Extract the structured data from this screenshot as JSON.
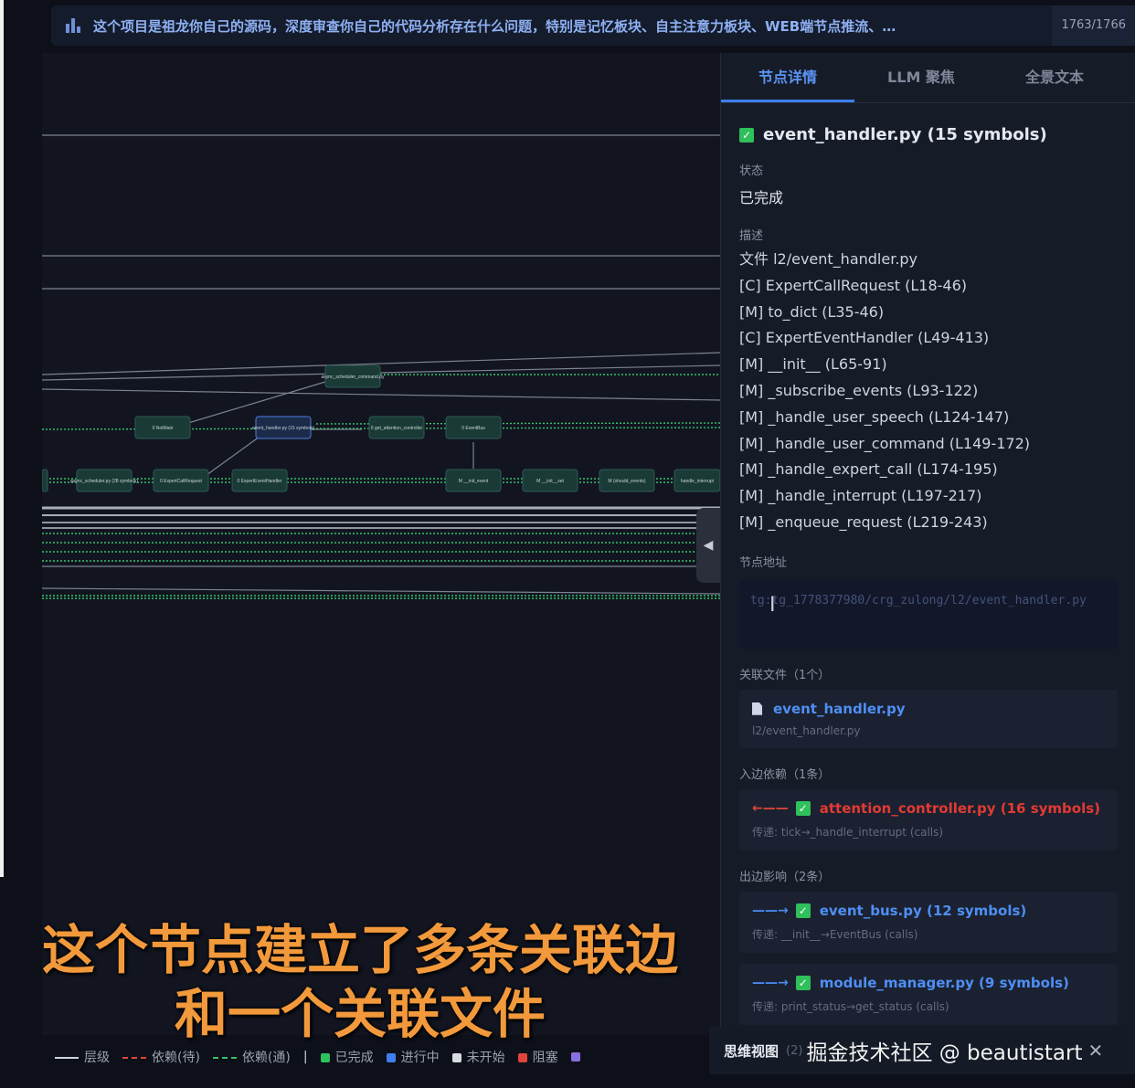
{
  "topbar": {
    "text": "这个项目是祖龙你自己的源码，深度审查你自己的代码分析存在什么问题，特别是记忆板块、自主注意力板块、WEB端节点推流、…",
    "count": "1763/1766",
    "icon": "bar-chart-icon"
  },
  "graph": {
    "nodes": [
      {
        "label": "async_scheduler_command.py"
      },
      {
        "label": "0 NotMain"
      },
      {
        "label": "event_handler.py (15 symbols)"
      },
      {
        "label": "0 get_attention_controller"
      },
      {
        "label": "0 EventBus"
      },
      {
        "label": "async_scheduler.py (28 symbols)"
      },
      {
        "label": "0 ExpertCallRequest"
      },
      {
        "label": "0 ExpertEventHandler"
      },
      {
        "label": "M __init_event"
      },
      {
        "label": "M __init__set"
      },
      {
        "label": "M (should_events)"
      },
      {
        "label": "handle_interrupt"
      }
    ],
    "collapse_icon": "triangle-left-icon"
  },
  "panel": {
    "tabs": [
      {
        "label": "节点详情",
        "active": true
      },
      {
        "label": "LLM 聚焦",
        "active": false
      },
      {
        "label": "全景文本",
        "active": false
      }
    ],
    "title": "event_handler.py (15 symbols)",
    "status_label": "状态",
    "status_value": "已完成",
    "desc_label": "描述",
    "desc_lines": [
      "文件 l2/event_handler.py",
      "[C] ExpertCallRequest (L18-46)",
      "[M] to_dict (L35-46)",
      "[C] ExpertEventHandler (L49-413)",
      "[M] __init__ (L65-91)",
      "[M] _subscribe_events (L93-122)",
      "[M] _handle_user_speech (L124-147)",
      "[M] _handle_user_command (L149-172)",
      "[M] _handle_expert_call (L174-195)",
      "[M] _handle_interrupt (L197-217)",
      "[M] _enqueue_request (L219-243)"
    ],
    "addr_label": "节点地址",
    "addr_value": "tg:tg_1778377980/crg_zulong/l2/event_handler.py",
    "files_label": "关联文件（1个）",
    "file": {
      "name": "event_handler.py",
      "path": "l2/event_handler.py",
      "icon": "file-icon"
    },
    "in_label": "入边依赖（1条）",
    "in_edges": [
      {
        "arrow": "←——",
        "name": "attention_controller.py (16 symbols)",
        "detail": "传递: tick→_handle_interrupt (calls)"
      }
    ],
    "out_label": "出边影响（2条）",
    "out_edges": [
      {
        "arrow": "——→",
        "name": "event_bus.py (12 symbols)",
        "detail": "传递: __init__→EventBus (calls)"
      },
      {
        "arrow": "——→",
        "name": "module_manager.py (9 symbols)",
        "detail": "传递: print_status→get_status (calls)"
      }
    ]
  },
  "legend": {
    "items": [
      {
        "label": "层级",
        "style": "solid",
        "color": "#d0d4dc"
      },
      {
        "label": "依赖(待)",
        "style": "dash-red",
        "color": "#e0443b"
      },
      {
        "label": "依赖(通)",
        "style": "dash-green",
        "color": "#39c06a"
      },
      {
        "label": "已完成",
        "style": "dot",
        "color": "#2fbf5b"
      },
      {
        "label": "进行中",
        "style": "dot",
        "color": "#3f7ff0"
      },
      {
        "label": "未开始",
        "style": "dot",
        "color": "#d8dbe2"
      },
      {
        "label": "阻塞",
        "style": "dot",
        "color": "#e0443b"
      },
      {
        "label": "",
        "style": "dot",
        "color": "#8a6fe0"
      }
    ],
    "separator": "|"
  },
  "bottom": {
    "mind_view": "思维视图",
    "num": "(2)",
    "watermark": "掘金技术社区 @ beautistart",
    "close": "✕"
  },
  "subtitle": {
    "line1": "这个节点建立了多条关联边",
    "line2": "和一个关联文件"
  },
  "colors": {
    "accent": "#3f7ff0",
    "done": "#2fbf5b",
    "danger": "#e0443b",
    "subtitle": "#f2993c"
  }
}
